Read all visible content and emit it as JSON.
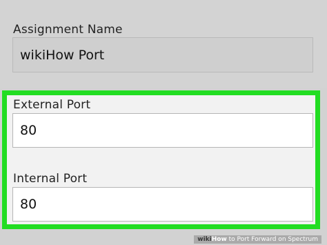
{
  "form": {
    "assignment": {
      "label": "Assignment Name",
      "value": "wikiHow Port"
    },
    "external_port": {
      "label": "External Port",
      "value": "80"
    },
    "internal_port": {
      "label": "Internal Port",
      "value": "80"
    }
  },
  "watermark": {
    "brand": "wiki",
    "brand_bold": "How",
    "title": " to Port Forward on Spectrum"
  },
  "colors": {
    "highlight": "#22dd22",
    "disabled_bg": "#d3d3d3",
    "field_bg": "#ffffff"
  }
}
